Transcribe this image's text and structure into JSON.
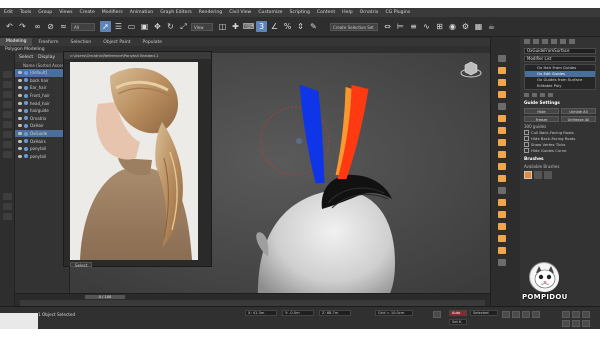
{
  "menu": {
    "items": [
      "Edit",
      "Tools",
      "Group",
      "Views",
      "Create",
      "Modifiers",
      "Animation",
      "Graph Editors",
      "Rendering",
      "Civil View",
      "Customize",
      "Scripting",
      "Content",
      "Help",
      "Ornatrix",
      "CG Plugins"
    ]
  },
  "toolbar": {
    "filter_value": "All",
    "view_value": "View",
    "selection_set_value": "Create Selection Set"
  },
  "ribbon": {
    "tabs": [
      "Modeling",
      "Freeform",
      "Selection",
      "Object Paint",
      "Populate"
    ],
    "sub_label": "Polygon Modeling"
  },
  "scene_explorer": {
    "tabs": [
      "Select",
      "Display"
    ],
    "header": "Name (Sorted Ascend",
    "rows": [
      {
        "label": "[default]",
        "selected": true
      },
      {
        "label": "back hair",
        "selected": false
      },
      {
        "label": "Ear_hair",
        "selected": false
      },
      {
        "label": "Front_hair",
        "selected": false
      },
      {
        "label": "head_hair",
        "selected": false
      },
      {
        "label": "hairguide",
        "selected": false
      },
      {
        "label": "Ornatrix",
        "selected": false
      },
      {
        "label": "OxHair",
        "selected": false
      },
      {
        "label": "OxGuide",
        "selected": true
      },
      {
        "label": "OxHairs",
        "selected": false
      },
      {
        "label": "ponytail",
        "selected": false
      },
      {
        "label": "ponytail",
        "selected": false
      }
    ]
  },
  "viewport": {
    "label": "[+] [Perspective] [Standard] [Default Shading]"
  },
  "reference_window": {
    "title": "c:\\Users\\Ornatrix\\Reference\\Ponytail Braided.1",
    "select_button": "Select"
  },
  "command_panel": {
    "object_name": "OxGuideFromSurface",
    "modifier_list_label": "Modifier List",
    "stack": [
      {
        "label": "Ox Hair From Guides",
        "selected": false
      },
      {
        "label": "Ox Edit Guides",
        "selected": true
      },
      {
        "label": "Ox Guides from Surface",
        "selected": false
      },
      {
        "label": "Editable Poly",
        "selected": false
      }
    ],
    "guide_settings_title": "Guide Settings",
    "btn_hide": "Hide",
    "btn_unhide_all": "Unhide All",
    "btn_freeze": "Freeze",
    "btn_unfreeze_all": "Unfreeze All",
    "guide_count": "300 guides",
    "checks": [
      "Cull Back-Facing Roots",
      "Hide Back-Facing Roots",
      "Show Vertex Ticks",
      "Hide Guides Curve"
    ],
    "brushes_title": "Brushes",
    "available_brushes_label": "Available Brushes",
    "watermark": "POMPIDOU"
  },
  "timeline": {
    "slider_value": "0 / 100"
  },
  "status": {
    "selection": "1 Object Selected",
    "x_value": "X: 41.3m",
    "y_value": "Y: -0.0m",
    "z_value": "Z: 68.7m",
    "grid_value": "Grid = 10.0cm",
    "auto_key": "Auto",
    "selected_value": "Selected",
    "set_key": "Set K."
  },
  "colors": {
    "accent_blue": "#4a6f9c",
    "toolbar_highlight": "#5d86b7",
    "strand_blue": "#1036e8",
    "strand_red": "#ff3a12",
    "strand_orange": "#ff9a2e",
    "icon_orange": "#f0a64a"
  }
}
